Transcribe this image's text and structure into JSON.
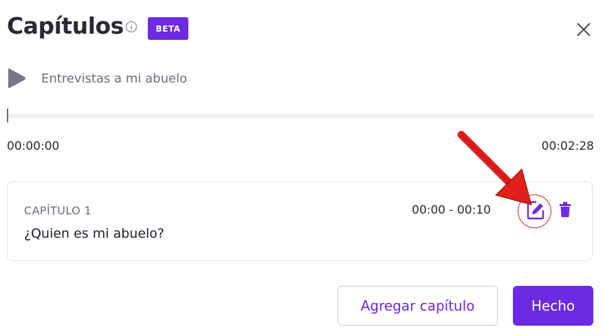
{
  "dialog": {
    "title": "Capítulos",
    "badge": "BETA",
    "accent_color": "#6d2ae2",
    "icons": [
      "info-icon",
      "close-icon",
      "play-icon",
      "edit-icon",
      "trash-icon"
    ]
  },
  "player": {
    "track_title": "Entrevistas a mi abuelo",
    "time_start": "00:00:00",
    "time_end": "00:02:28",
    "progress": 0
  },
  "chapters": [
    {
      "label": "CAPÍTULO 1",
      "title": "¿Quien es mi abuelo?",
      "time_range": "00:00 - 00:10"
    }
  ],
  "buttons": {
    "add_chapter": "Agregar capítulo",
    "done": "Hecho"
  },
  "annotation": {
    "arrow_color": "#e0201a",
    "highlight_target": "edit-icon"
  }
}
